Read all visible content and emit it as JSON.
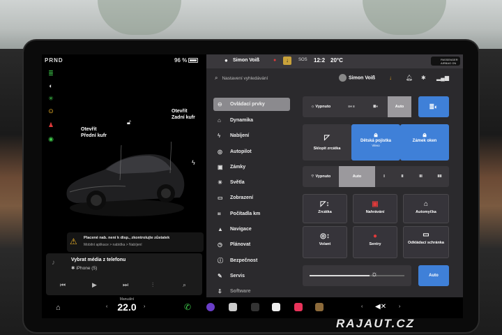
{
  "left": {
    "gear": "PRND",
    "battery": "96 %",
    "labels": {
      "frunk": "Otevřít\nPřední kufr",
      "trunk": "Otevřít\nZadní kufr"
    },
    "notice": {
      "title": "Placené nab. není k disp., zkontrolujte zůstatek",
      "sub": "Mobilní aplikace > nabídka > Nabíjení"
    },
    "media": {
      "title": "Vybrat média z telefonu",
      "source": "iPhone (5)"
    }
  },
  "status": {
    "driver": "Simon Voiß",
    "time": "12:2",
    "temp": "20°C",
    "airbag": "PASSENGER AIRBAG ON"
  },
  "header": {
    "search_placeholder": "Nastavení vyhledávání",
    "profile": "Simon Voiß"
  },
  "menu": [
    {
      "label": "Ovládací prvky",
      "icon": "toggle-icon",
      "active": true
    },
    {
      "label": "Dynamika",
      "icon": "car-icon"
    },
    {
      "label": "Nabíjení",
      "icon": "bolt-icon"
    },
    {
      "label": "Autopilot",
      "icon": "steering-icon"
    },
    {
      "label": "Zámky",
      "icon": "lock-icon"
    },
    {
      "label": "Světla",
      "icon": "light-icon"
    },
    {
      "label": "Zobrazení",
      "icon": "display-icon"
    },
    {
      "label": "Počítadla km",
      "icon": "odometer-icon"
    },
    {
      "label": "Navigace",
      "icon": "navigation-icon"
    },
    {
      "label": "Plánovat",
      "icon": "clock-icon"
    },
    {
      "label": "Bezpečnost",
      "icon": "shield-icon"
    },
    {
      "label": "Servis",
      "icon": "wrench-icon"
    },
    {
      "label": "Software",
      "icon": "download-icon"
    }
  ],
  "controls": {
    "lights": [
      "Vypnuto",
      "Auto"
    ],
    "mirror": "Sklopit zrcátka",
    "child_lock": "Dětská pojistka",
    "child_lock_sub": "Vlevo",
    "window_lock": "Zámek oken",
    "wipers": [
      "Vypnuto",
      "Auto",
      "I",
      "II",
      "III",
      "IIII"
    ],
    "tiles": [
      "Zrcátka",
      "Nahrávání",
      "Automyčka",
      "Volant",
      "Sentry",
      "Odkládací schránka"
    ],
    "brightness": "Auto"
  },
  "taskbar": {
    "temp_label": "Manuální",
    "temp": "22.0"
  },
  "watermark": "RAJAUT.CZ",
  "colors": {
    "accent_blue": "#3f80d8",
    "panel": "#2b2a2d",
    "warning": "#f0b428"
  }
}
